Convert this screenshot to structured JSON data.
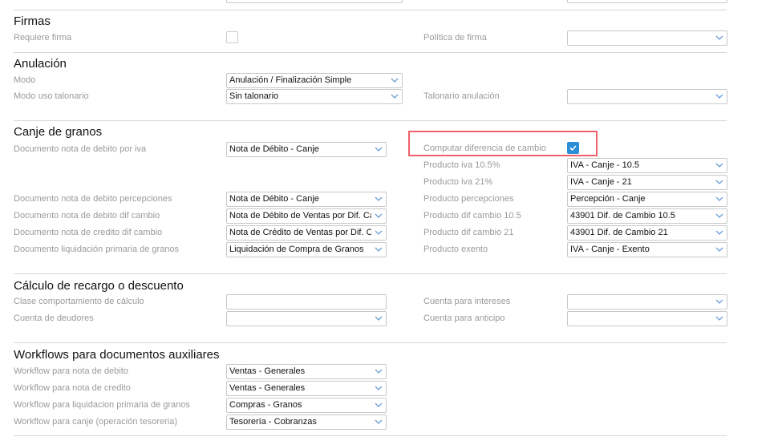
{
  "firmas": {
    "title": "Firmas",
    "requiere_firma": "Requiere firma",
    "politica_firma": "Política de firma",
    "politica_value": ""
  },
  "anulacion": {
    "title": "Anulación",
    "modo": "Modo",
    "modo_value": "Anulación / Finalización Simple",
    "modo_uso": "Modo uso talonario",
    "modo_uso_value": "Sin talonario",
    "talonario": "Talonario anulación",
    "talonario_value": ""
  },
  "canje": {
    "title": "Canje de granos",
    "left": [
      {
        "label": "Documento nota de debito por iva",
        "value": "Nota de Débito - Canje"
      },
      {
        "label": "Documento nota de debito percepciones",
        "value": "Nota de Débito - Canje"
      },
      {
        "label": "Documento nota de debito dif cambio",
        "value": "Nota de Débito de Ventas por Dif. Ca"
      },
      {
        "label": "Documento nota de credito dif cambio",
        "value": "Nota de Crédito de Ventas por Dif. C:"
      },
      {
        "label": "Documento liquidación primaria de granos",
        "value": "Liquidación de Compra de Granos"
      }
    ],
    "computar": "Computar diferencia de cambio",
    "computar_checked": true,
    "right": [
      {
        "label": "Producto iva 10.5%",
        "value": "IVA - Canje - 10.5"
      },
      {
        "label": "Producto iva 21%",
        "value": "IVA - Canje - 21"
      },
      {
        "label": "Producto percepciones",
        "value": "Percepción - Canje"
      },
      {
        "label": "Producto dif cambio 10.5",
        "value": "43901 Dif. de Cambio 10.5"
      },
      {
        "label": "Producto dif cambio 21",
        "value": "43901 Dif. de Cambio 21"
      },
      {
        "label": "Producto exento",
        "value": "IVA - Canje - Exento"
      }
    ]
  },
  "calculo": {
    "title": "Cálculo de recargo o descuento",
    "clase": "Clase comportamiento de cálculo",
    "deudores": "Cuenta de deudores",
    "intereses": "Cuenta para intereses",
    "anticipo": "Cuenta para anticipo"
  },
  "workflows": {
    "title": "Workflows para documentos auxiliares",
    "items": [
      {
        "label": "Workflow para nota de debito",
        "value": "Ventas - Generales"
      },
      {
        "label": "Workflow para nota de credito",
        "value": "Ventas - Generales"
      },
      {
        "label": "Workflow para liquidacion primaria de granos",
        "value": "Compras - Granos"
      },
      {
        "label": "Workflow para canje (operación tesoreria)",
        "value": "Tesorería - Cobranzas"
      }
    ]
  },
  "colors": {
    "highlight": "#f0606a",
    "accent": "#2a8fd6"
  }
}
